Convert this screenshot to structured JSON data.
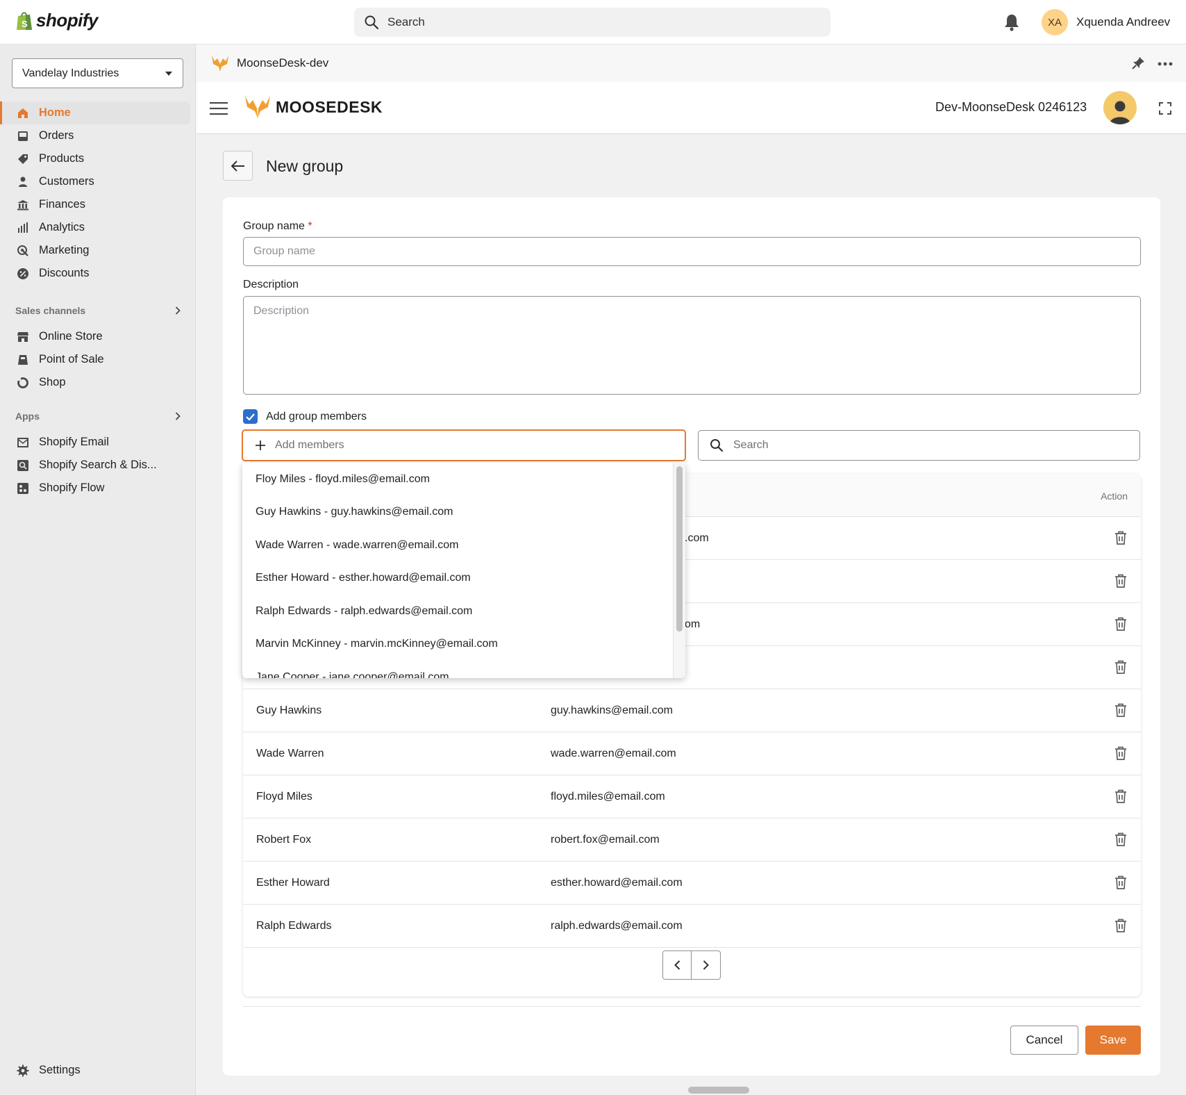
{
  "topbar": {
    "logo_text": "shopify",
    "search_placeholder": "Search",
    "user_initials": "XA",
    "user_name": "Xquenda Andreev"
  },
  "sidebar": {
    "store": "Vandelay Industries",
    "main_items": [
      {
        "label": "Home",
        "icon": "home-icon",
        "active": true
      },
      {
        "label": "Orders",
        "icon": "orders-icon"
      },
      {
        "label": "Products",
        "icon": "tag-icon"
      },
      {
        "label": "Customers",
        "icon": "person-icon"
      },
      {
        "label": "Finances",
        "icon": "bank-icon"
      },
      {
        "label": "Analytics",
        "icon": "bar-chart-icon"
      },
      {
        "label": "Marketing",
        "icon": "target-icon"
      },
      {
        "label": "Discounts",
        "icon": "discount-icon"
      }
    ],
    "sales_channels": {
      "heading": "Sales channels",
      "items": [
        "Online Store",
        "Point of Sale",
        "Shop"
      ]
    },
    "apps": {
      "heading": "Apps",
      "items": [
        "Shopify Email",
        "Shopify Search & Dis...",
        "Shopify Flow"
      ]
    },
    "settings_label": "Settings"
  },
  "app": {
    "title": "MoonseDesk-dev",
    "brand": "MOOSEDESK",
    "account": "Dev-MoonseDesk 0246123"
  },
  "page": {
    "title": "New group",
    "group_name_label": "Group name",
    "required_mark": "*",
    "group_name_placeholder": "Group name",
    "description_label": "Description",
    "description_placeholder": "Description",
    "add_members_checkbox": "Add group members",
    "add_members_placeholder": "Add members",
    "search_placeholder": "Search",
    "action_header": "Action",
    "cancel": "Cancel",
    "save": "Save"
  },
  "dropdown_options": [
    "Floy Miles - floyd.miles@email.com",
    "Guy Hawkins - guy.hawkins@email.com",
    "Wade Warren - wade.warren@email.com",
    "Esther Howard - esther.howard@email.com",
    "Ralph Edwards - ralph.edwards@email.com",
    "Marvin McKinney - marvin.mcKinney@email.com",
    "Jane Cooper - jane.cooper@email.com"
  ],
  "members_hidden": [
    {
      "email_tail": ".com"
    },
    {
      "email_tail": ""
    },
    {
      "email_tail": "om"
    },
    {
      "email_tail": ""
    }
  ],
  "members": [
    {
      "name": "Guy Hawkins",
      "email": "guy.hawkins@email.com"
    },
    {
      "name": "Wade Warren",
      "email": "wade.warren@email.com"
    },
    {
      "name": "Floyd Miles",
      "email": "floyd.miles@email.com"
    },
    {
      "name": "Robert Fox",
      "email": "robert.fox@email.com"
    },
    {
      "name": "Esther Howard",
      "email": "esther.howard@email.com"
    },
    {
      "name": "Ralph Edwards",
      "email": "ralph.edwards@email.com"
    }
  ],
  "colors": {
    "accent": "#e5792f",
    "checkbox": "#2c6ecb"
  }
}
